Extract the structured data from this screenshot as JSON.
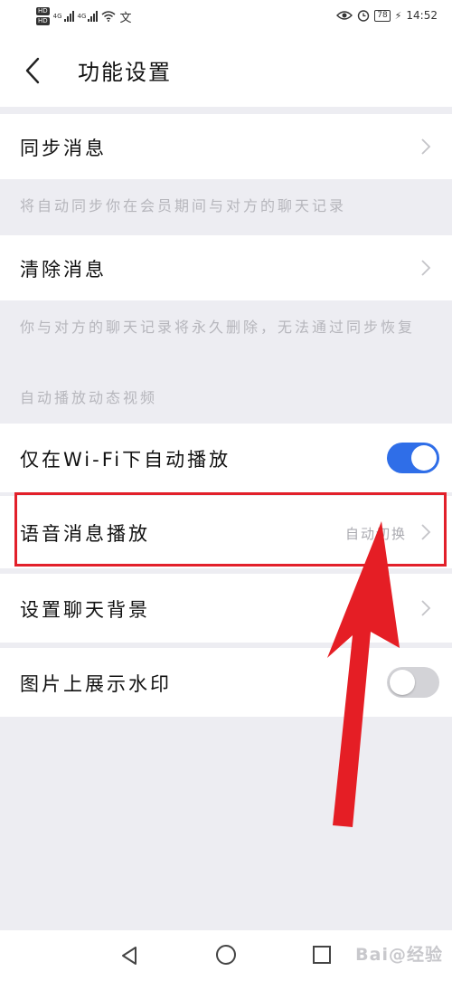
{
  "status_bar": {
    "hd_top": "HD",
    "hd_bottom": "HD",
    "network_1": "4G",
    "network_2": "4G",
    "extra_icon": "文",
    "battery": "78",
    "time": "14:52",
    "icons": [
      "eye-icon",
      "alarm-icon",
      "charging-icon"
    ]
  },
  "header": {
    "title": "功能设置",
    "back_icon": "chevron-left-icon"
  },
  "settings": {
    "sync": {
      "label": "同步消息",
      "note": "将自动同步你在会员期间与对方的聊天记录"
    },
    "clear": {
      "label": "清除消息",
      "note": "你与对方的聊天记录将永久删除，无法通过同步恢复"
    },
    "section_autoplay": "自动播放动态视频",
    "wifi_autoplay": {
      "label": "仅在Wi-Fi下自动播放",
      "enabled": true
    },
    "voice_play": {
      "label": "语音消息播放",
      "value": "自动切换"
    },
    "chat_bg": {
      "label": "设置聊天背景"
    },
    "watermark": {
      "label": "图片上展示水印",
      "enabled": false
    }
  },
  "colors": {
    "toggle_on": "#2f6ee8",
    "highlight": "#e2202a",
    "background": "#ededf2"
  },
  "nav": {
    "watermark_text": "Bai@经验"
  }
}
